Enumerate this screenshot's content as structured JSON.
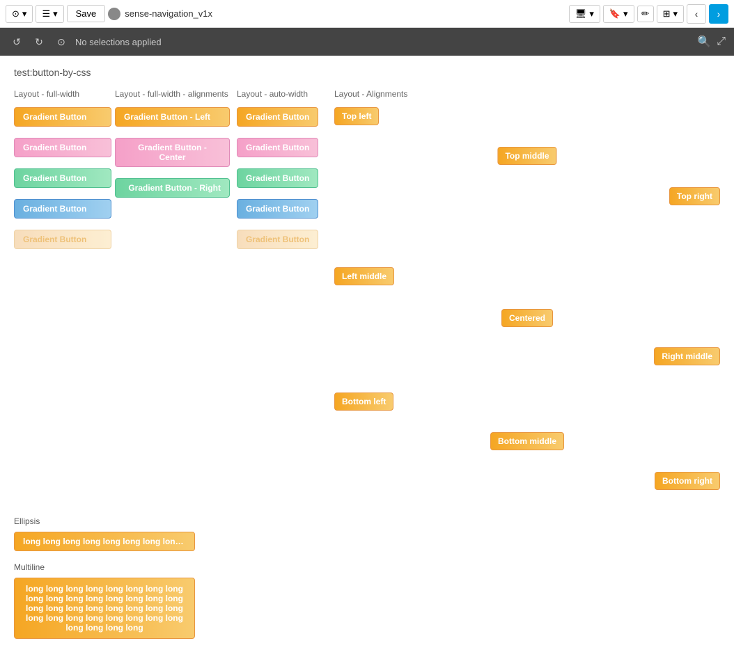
{
  "topbar": {
    "save_label": "Save",
    "app_name": "sense-navigation_v1x",
    "no_selections": "No selections applied"
  },
  "page": {
    "title": "test:button-by-css"
  },
  "sections": {
    "col1_header": "Layout - full-width",
    "col2_header": "Layout - full-width - alignments",
    "col3_header": "Layout - auto-width",
    "col4_header": "Layout - Alignments"
  },
  "buttons": {
    "gradient_button": "Gradient Button",
    "gradient_button_left": "Gradient Button - Left",
    "gradient_button_center": "Gradient Button - Center",
    "gradient_button_right": "Gradient Button - Right",
    "top_left": "Top left",
    "top_middle": "Top middle",
    "top_right": "Top right",
    "left_middle": "Left middle",
    "centered": "Centered",
    "right_middle": "Right middle",
    "bottom_left": "Bottom left",
    "bottom_middle": "Bottom middle",
    "bottom_right": "Bottom right"
  },
  "ellipsis": {
    "label": "Ellipsis",
    "long_text": "long long long long long long long long l..."
  },
  "multiline": {
    "label": "Multiline",
    "long_text": "long long long long long long long long long long long long long long long long long long long long long long long long long long long long long long long long long long long long"
  }
}
